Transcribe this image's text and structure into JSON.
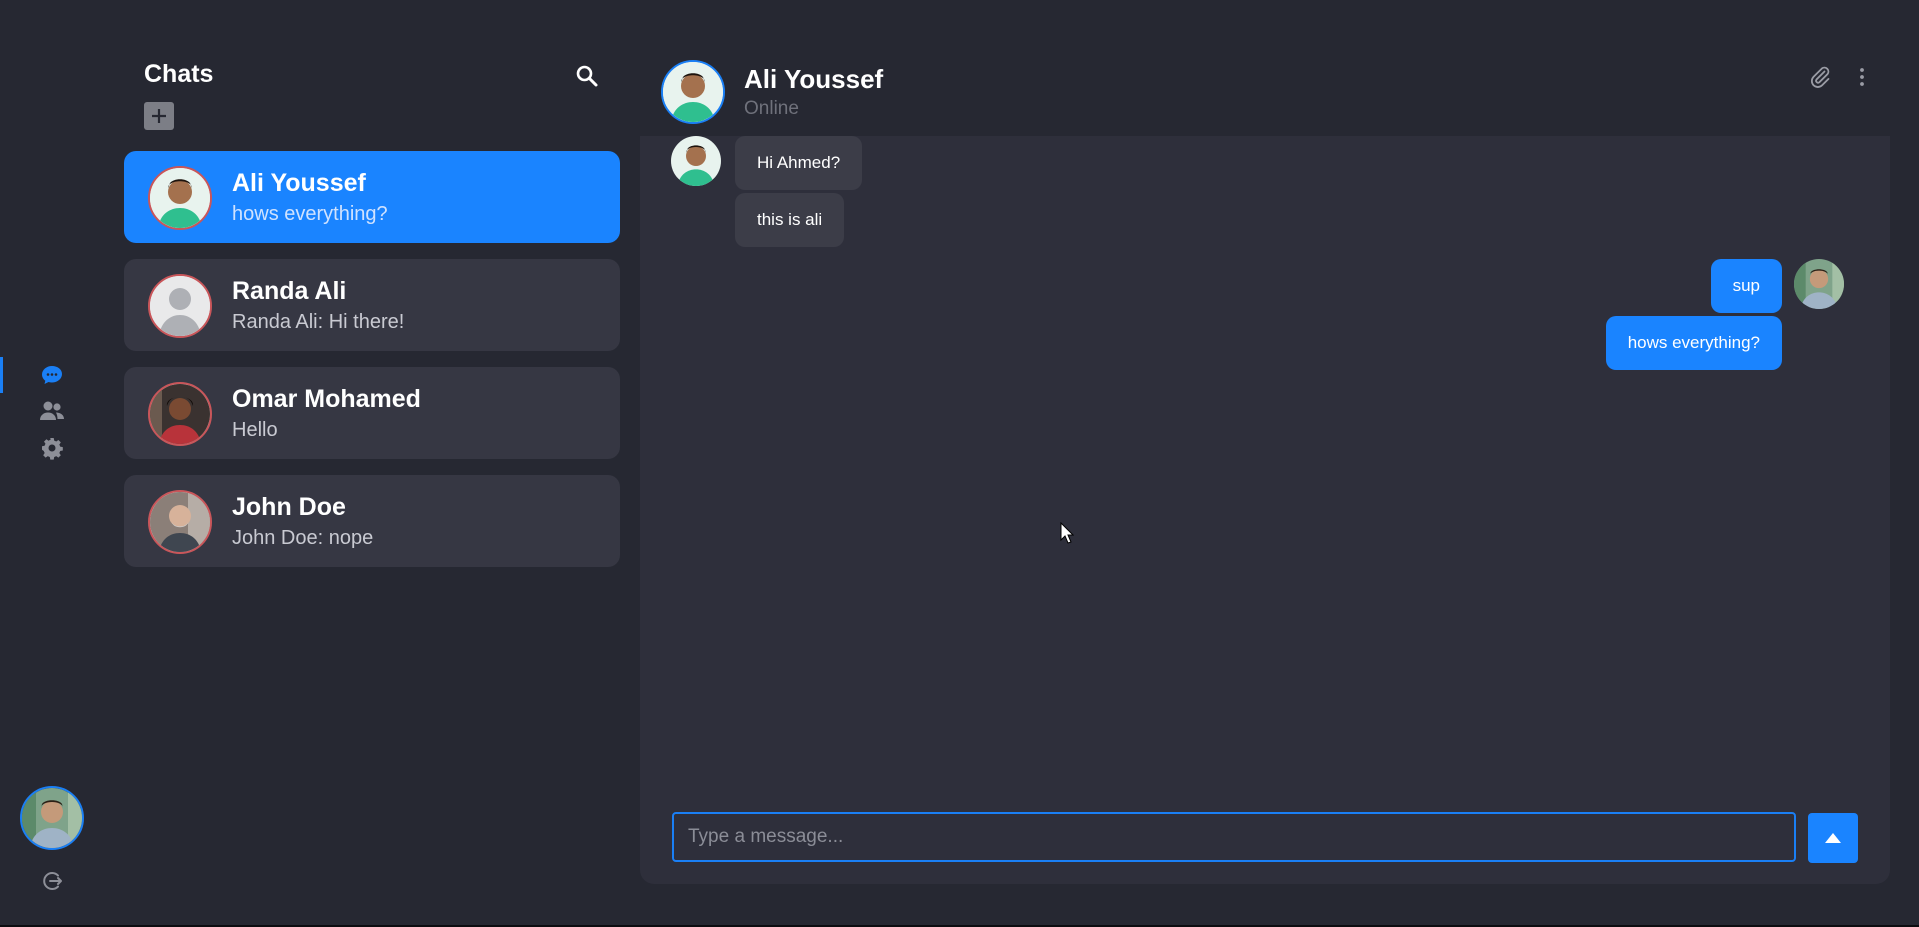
{
  "colors": {
    "accent": "#1a84ff",
    "background": "#262832",
    "panel": "#2e2f3b",
    "card": "#363743",
    "incoming_bubble": "#3c3d48"
  },
  "rail": {
    "items": [
      {
        "icon": "chat-bubble-icon",
        "active": true
      },
      {
        "icon": "contacts-icon",
        "active": false
      },
      {
        "icon": "gear-icon",
        "active": false
      }
    ],
    "bottom": {
      "avatar": "user-avatar",
      "logout_icon": "logout-icon"
    }
  },
  "sidebar": {
    "title": "Chats",
    "search_icon": "search-icon",
    "add_icon": "plus-icon",
    "chats": [
      {
        "name": "Ali Youssef",
        "last_message": "hows everything?",
        "active": true
      },
      {
        "name": "Randa Ali",
        "last_message": "Randa Ali: Hi there!",
        "active": false
      },
      {
        "name": "Omar Mohamed",
        "last_message": "Hello",
        "active": false
      },
      {
        "name": "John Doe",
        "last_message": "John Doe: nope",
        "active": false
      }
    ]
  },
  "conversation": {
    "contact_name": "Ali Youssef",
    "status": "Online",
    "header_icons": [
      "paperclip-icon",
      "more-vertical-icon"
    ],
    "messages": [
      {
        "text": "Hi Ahmed?",
        "direction": "in"
      },
      {
        "text": "this is ali",
        "direction": "in"
      },
      {
        "text": "sup",
        "direction": "out"
      },
      {
        "text": "hows everything?",
        "direction": "out"
      }
    ],
    "composer": {
      "placeholder": "Type a message...",
      "value": ""
    },
    "send_icon": "send-arrow-icon"
  }
}
